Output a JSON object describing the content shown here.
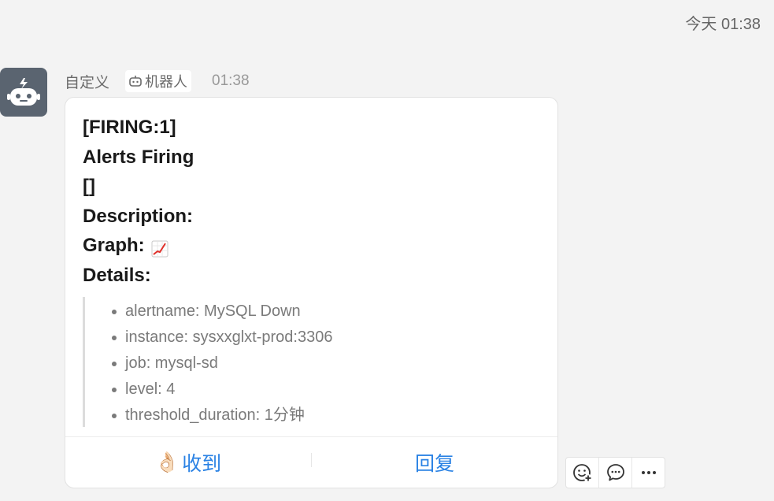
{
  "header": {
    "timestamp": "今天 01:38"
  },
  "message": {
    "sender_name": "自定义",
    "bot_tag_label": "机器人",
    "sent_time": "01:38",
    "card": {
      "lines": {
        "firing": "[FIRING:1]",
        "alerts_firing": "Alerts Firing",
        "brackets": "[]",
        "description": "Description:",
        "graph": "Graph:",
        "details": "Details:"
      },
      "detail_items": [
        "alertname: MySQL Down",
        "instance: sysxxglxt-prod:3306",
        "job: mysql-sd",
        "level: 4",
        "threshold_duration: 1分钟"
      ],
      "actions": {
        "received_emoji": "👌🏻",
        "received_label": "收到",
        "reply_label": "回复"
      }
    }
  },
  "toolbar": {
    "icons": [
      "add-reaction-icon",
      "comment-icon",
      "more-icon"
    ]
  },
  "colors": {
    "background": "#f3f3f3",
    "accent": "#2a82e4",
    "avatar_bg": "#5a6470"
  }
}
